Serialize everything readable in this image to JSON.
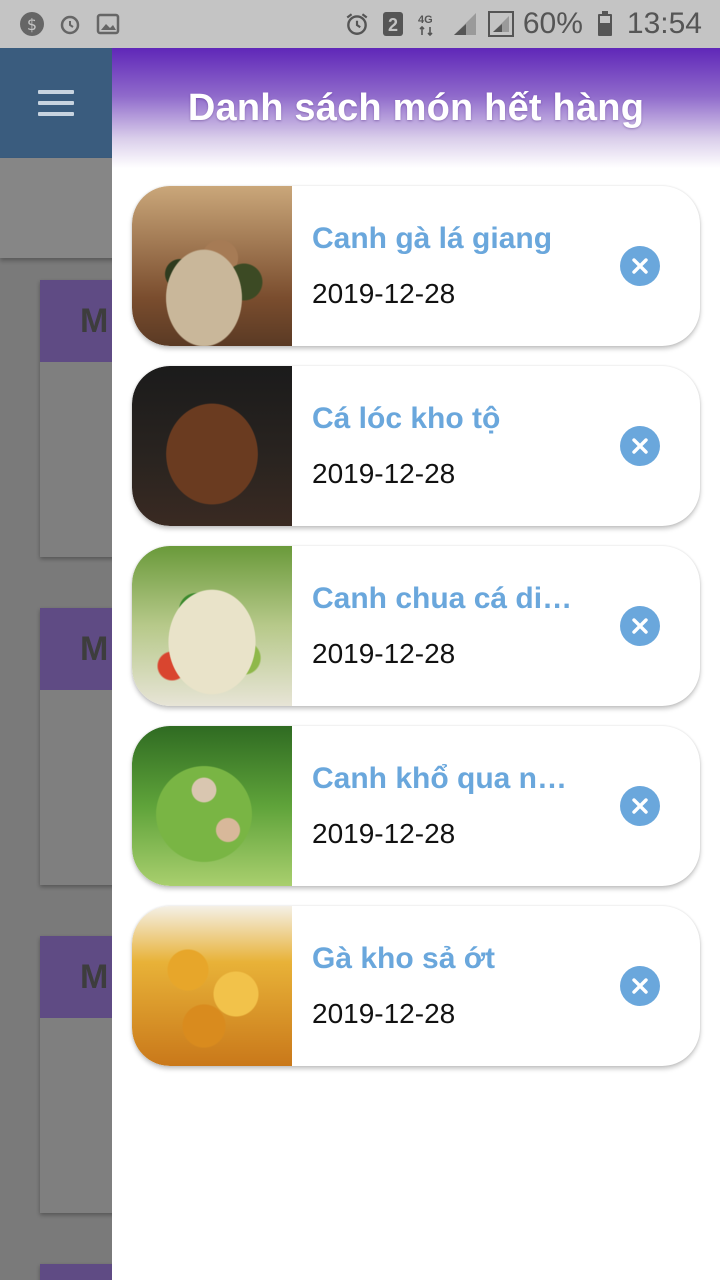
{
  "status_bar": {
    "battery": "60%",
    "time": "13:54",
    "sim_slot": "2",
    "network": "4G"
  },
  "background": {
    "card_letter": "M"
  },
  "drawer": {
    "title": "Danh sách món hết hàng",
    "items": [
      {
        "name": "Canh gà lá giang",
        "date": "2019-12-28"
      },
      {
        "name": "Cá lóc kho tộ",
        "date": "2019-12-28"
      },
      {
        "name": "Canh chua cá diêu hồng",
        "date": "2019-12-28"
      },
      {
        "name": "Canh khổ qua nhồi thịt",
        "date": "2019-12-28"
      },
      {
        "name": "Gà kho sả ớt",
        "date": "2019-12-28"
      }
    ]
  },
  "icons": {
    "remove": "close-circle-icon",
    "menu": "hamburger-icon"
  },
  "colors": {
    "accent_blue": "#6aa7dc",
    "header_purple": "#5f27b8",
    "toolbar": "#3a5c7e"
  }
}
